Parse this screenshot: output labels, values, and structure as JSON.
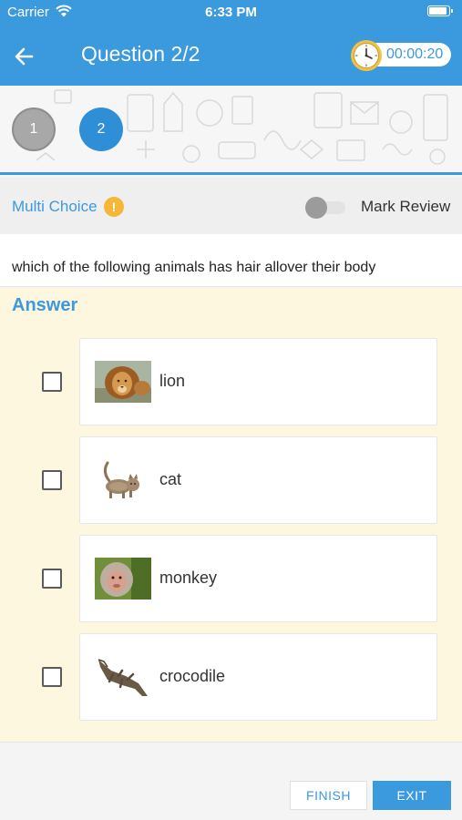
{
  "status_bar": {
    "carrier": "Carrier",
    "time": "6:33 PM"
  },
  "header": {
    "title": "Question 2/2",
    "timer": "00:00:20",
    "back_icon": "arrow-left-icon",
    "clock_icon": "clock-icon"
  },
  "question_nav": [
    {
      "label": "1",
      "state": "answered"
    },
    {
      "label": "2",
      "state": "current"
    }
  ],
  "question_type": {
    "label": "Multi Choice",
    "info_icon": "!"
  },
  "mark_review": {
    "label": "Mark Review",
    "enabled": false
  },
  "question": {
    "text": "which of the following animals has hair allover their body"
  },
  "answer": {
    "title": "Answer",
    "options": [
      {
        "label": "lion",
        "image": "lion-image",
        "checked": false
      },
      {
        "label": "cat",
        "image": "cat-image",
        "checked": false
      },
      {
        "label": "monkey",
        "image": "monkey-image",
        "checked": false
      },
      {
        "label": "crocodile",
        "image": "crocodile-image",
        "checked": false
      }
    ]
  },
  "footer": {
    "finish_label": "FINISH",
    "exit_label": "EXIT"
  },
  "colors": {
    "primary": "#3b99dd",
    "answer_bg": "#fdf7df",
    "warning": "#f5b73a"
  }
}
